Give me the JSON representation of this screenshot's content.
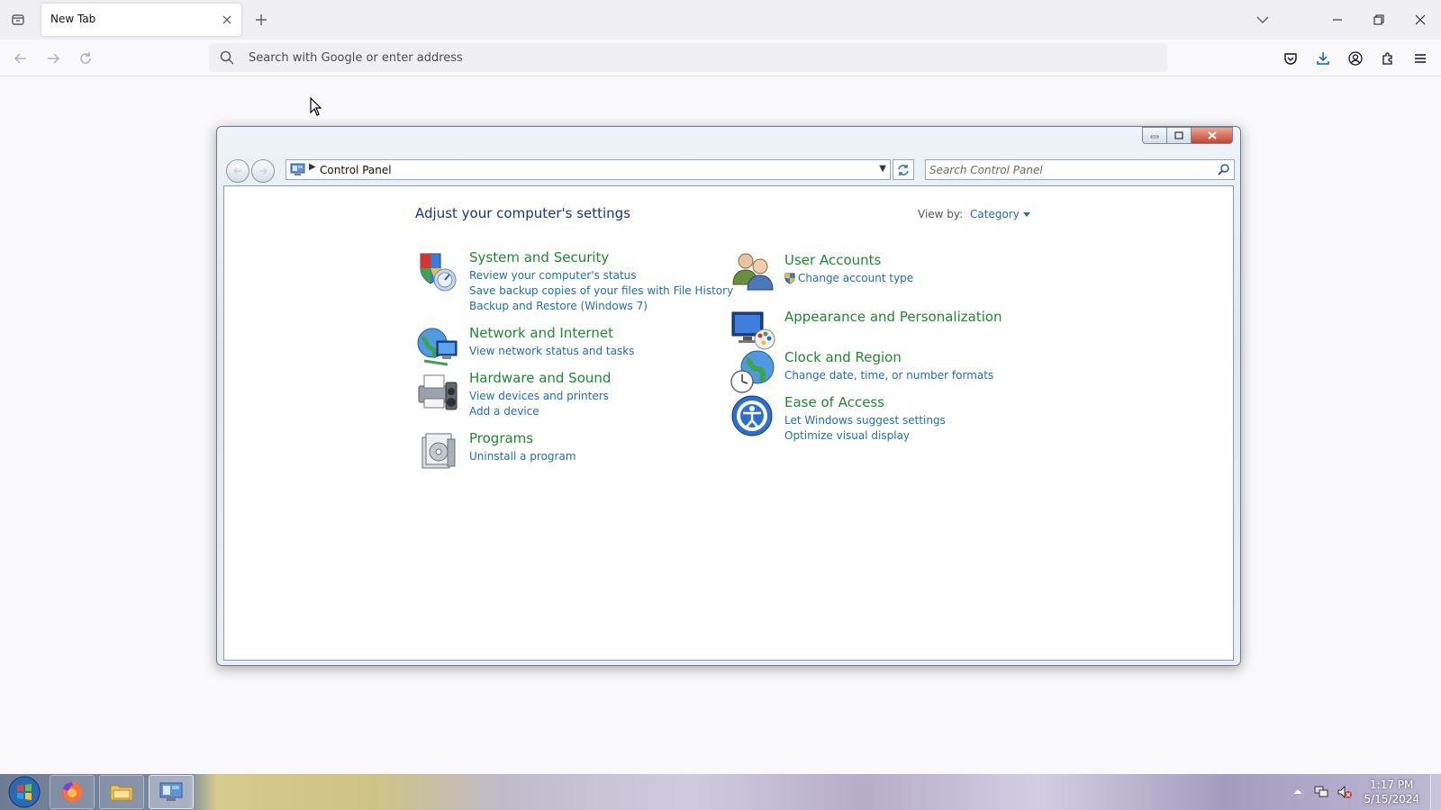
{
  "browser": {
    "tab_title": "New Tab",
    "urlbar_placeholder": "Search with Google or enter address"
  },
  "control_panel": {
    "address_text": "Control Panel",
    "search_placeholder": "Search Control Panel",
    "heading": "Adjust your computer's settings",
    "view_by_label": "View by:",
    "view_by_value": "Category",
    "categories": [
      {
        "title": "System and Security",
        "icon": "shield-icon",
        "links": [
          "Review your computer's status",
          "Save backup copies of your files with File History",
          "Backup and Restore (Windows 7)"
        ]
      },
      {
        "title": "Network and Internet",
        "icon": "network-globe-icon",
        "links": [
          "View network status and tasks"
        ]
      },
      {
        "title": "Hardware and Sound",
        "icon": "printer-icon",
        "links": [
          "View devices and printers",
          "Add a device"
        ]
      },
      {
        "title": "Programs",
        "icon": "programs-icon",
        "links": [
          "Uninstall a program"
        ]
      },
      {
        "title": "User Accounts",
        "icon": "users-icon",
        "links": [
          "Change account type"
        ]
      },
      {
        "title": "Appearance and Personalization",
        "icon": "monitor-palette-icon",
        "links": []
      },
      {
        "title": "Clock and Region",
        "icon": "clock-globe-icon",
        "links": [
          "Change date, time, or number formats"
        ]
      },
      {
        "title": "Ease of Access",
        "icon": "ease-of-access-icon",
        "links": [
          "Let Windows suggest settings",
          "Optimize visual display"
        ]
      }
    ]
  },
  "taskbar": {
    "time": "1:17 PM",
    "date": "5/15/2024"
  },
  "colors": {
    "category_title": "#1e8a2e",
    "link": "#1e6ebd",
    "heading": "#1e3287"
  }
}
